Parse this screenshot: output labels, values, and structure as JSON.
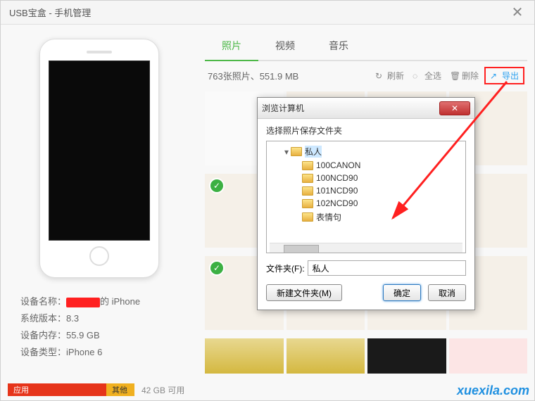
{
  "window": {
    "title": "USB宝盒 - 手机管理"
  },
  "device": {
    "name_label": "设备名称：",
    "name_suffix": "的 iPhone",
    "os_label": "系统版本：",
    "os_value": "8.3",
    "storage_label": "设备内存：",
    "storage_value": "55.9 GB",
    "type_label": "设备类型：",
    "type_value": "iPhone 6"
  },
  "tabs": {
    "photos": "照片",
    "videos": "视频",
    "music": "音乐"
  },
  "toolbar": {
    "summary": "763张照片、551.9 MB",
    "refresh": "刷新",
    "select_all": "全选",
    "delete": "删除",
    "export": "导出"
  },
  "storage": {
    "app": "应用",
    "other": "其他",
    "free": "42 GB 可用"
  },
  "dialog": {
    "title": "浏览计算机",
    "subtitle": "选择照片保存文件夹",
    "tree": {
      "root": "私人",
      "children": [
        "100CANON",
        "100NCD90",
        "101NCD90",
        "102NCD90",
        "表情句"
      ]
    },
    "folder_label": "文件夹(F):",
    "folder_value": "私人",
    "new_folder": "新建文件夹(M)",
    "ok": "确定",
    "cancel": "取消"
  },
  "watermark": "xuexila.com"
}
